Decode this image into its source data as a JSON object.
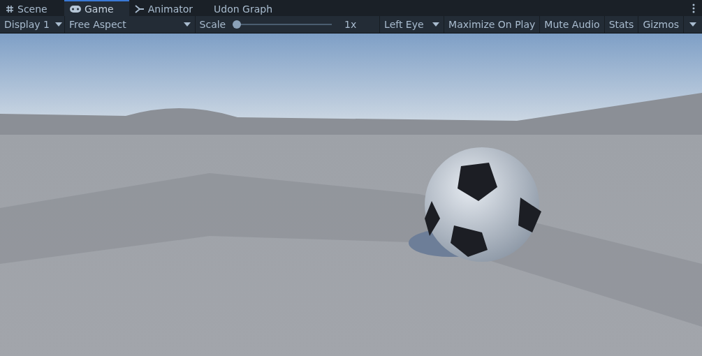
{
  "tabs": [
    {
      "label": "Scene",
      "kind": "scene",
      "selected": false
    },
    {
      "label": "Game",
      "kind": "game",
      "selected": true
    },
    {
      "label": "Animator",
      "kind": "animator",
      "selected": false
    },
    {
      "label": "Udon Graph",
      "kind": "none",
      "selected": false
    }
  ],
  "toolbar": {
    "display": "Display 1",
    "aspect": "Free Aspect",
    "scale_label": "Scale",
    "scale": {
      "level": 0
    },
    "scale_reading": "1x",
    "eye": "Left Eye",
    "toggles": [
      "Maximize On Play",
      "Mute Audio",
      "Stats"
    ],
    "gizmos": "Gizmos"
  }
}
